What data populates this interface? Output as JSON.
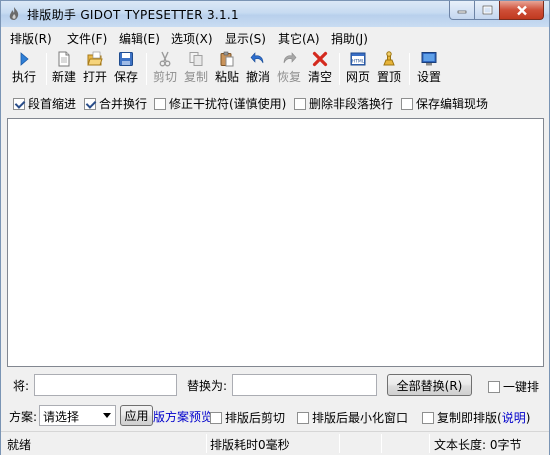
{
  "window": {
    "title": "排版助手 GIDOT TYPESETTER 3.1.1"
  },
  "menu": [
    "排版(R)",
    "文件(F)",
    "编辑(E)",
    "选项(X)",
    "显示(S)",
    "其它(A)",
    "捐助(J)"
  ],
  "toolbar": {
    "run": "执行",
    "new": "新建",
    "open": "打开",
    "save": "保存",
    "cut": "剪切",
    "copy": "复制",
    "paste": "粘贴",
    "undo": "撤消",
    "redo": "恢复",
    "clear": "清空",
    "webpage": "网页",
    "pin": "置顶",
    "settings": "设置"
  },
  "options": [
    {
      "label": "段首缩进",
      "checked": true
    },
    {
      "label": "合并换行",
      "checked": true
    },
    {
      "label": "修正干扰符(谨慎使用)",
      "checked": false
    },
    {
      "label": "删除非段落换行",
      "checked": false
    },
    {
      "label": "保存编辑现场",
      "checked": false
    }
  ],
  "replace": {
    "find_label": "将:",
    "replace_label": "替换为:",
    "replace_all_button": "全部替换(R)",
    "one_click_label": "一键排",
    "one_click_checked": false
  },
  "plan": {
    "label": "方案:",
    "select_value": "请选择",
    "apply_button": "应用",
    "preview_link": "版方案预览",
    "options": [
      {
        "label": "排版后剪切",
        "checked": false
      },
      {
        "label": "排版后最小化窗口",
        "checked": false
      }
    ],
    "copy_typeset": {
      "label": "复制即排版",
      "checked": false,
      "paren_open": "(",
      "help_link": "说明",
      "paren_close": ")"
    }
  },
  "status": {
    "state": "就绪",
    "elapsed": "排版耗时0毫秒",
    "length": "文本长度: 0字节"
  },
  "colors": {
    "close_button": "#c7402a",
    "link": "#0000cc",
    "title_gradient": "#c7dbf1"
  }
}
